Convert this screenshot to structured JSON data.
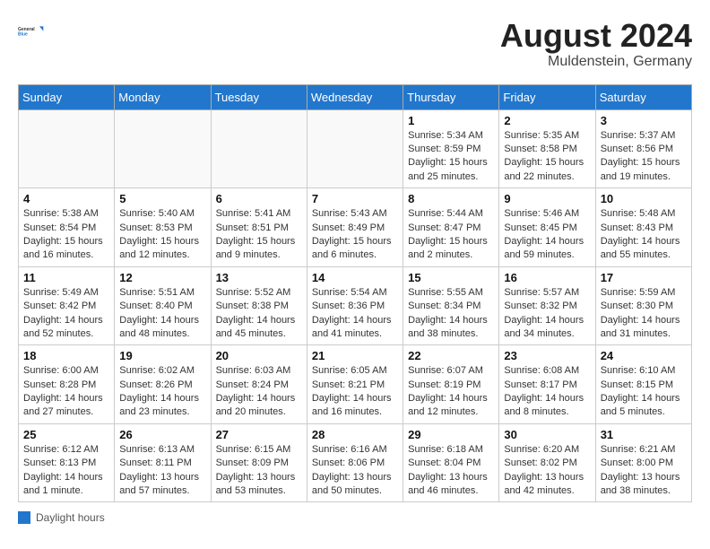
{
  "header": {
    "logo_general": "General",
    "logo_blue": "Blue",
    "month_title": "August 2024",
    "subtitle": "Muldenstein, Germany"
  },
  "footer": {
    "label": "Daylight hours"
  },
  "days_of_week": [
    "Sunday",
    "Monday",
    "Tuesday",
    "Wednesday",
    "Thursday",
    "Friday",
    "Saturday"
  ],
  "weeks": [
    [
      {
        "day": "",
        "info": ""
      },
      {
        "day": "",
        "info": ""
      },
      {
        "day": "",
        "info": ""
      },
      {
        "day": "",
        "info": ""
      },
      {
        "day": "1",
        "info": "Sunrise: 5:34 AM\nSunset: 8:59 PM\nDaylight: 15 hours\nand 25 minutes."
      },
      {
        "day": "2",
        "info": "Sunrise: 5:35 AM\nSunset: 8:58 PM\nDaylight: 15 hours\nand 22 minutes."
      },
      {
        "day": "3",
        "info": "Sunrise: 5:37 AM\nSunset: 8:56 PM\nDaylight: 15 hours\nand 19 minutes."
      }
    ],
    [
      {
        "day": "4",
        "info": "Sunrise: 5:38 AM\nSunset: 8:54 PM\nDaylight: 15 hours\nand 16 minutes."
      },
      {
        "day": "5",
        "info": "Sunrise: 5:40 AM\nSunset: 8:53 PM\nDaylight: 15 hours\nand 12 minutes."
      },
      {
        "day": "6",
        "info": "Sunrise: 5:41 AM\nSunset: 8:51 PM\nDaylight: 15 hours\nand 9 minutes."
      },
      {
        "day": "7",
        "info": "Sunrise: 5:43 AM\nSunset: 8:49 PM\nDaylight: 15 hours\nand 6 minutes."
      },
      {
        "day": "8",
        "info": "Sunrise: 5:44 AM\nSunset: 8:47 PM\nDaylight: 15 hours\nand 2 minutes."
      },
      {
        "day": "9",
        "info": "Sunrise: 5:46 AM\nSunset: 8:45 PM\nDaylight: 14 hours\nand 59 minutes."
      },
      {
        "day": "10",
        "info": "Sunrise: 5:48 AM\nSunset: 8:43 PM\nDaylight: 14 hours\nand 55 minutes."
      }
    ],
    [
      {
        "day": "11",
        "info": "Sunrise: 5:49 AM\nSunset: 8:42 PM\nDaylight: 14 hours\nand 52 minutes."
      },
      {
        "day": "12",
        "info": "Sunrise: 5:51 AM\nSunset: 8:40 PM\nDaylight: 14 hours\nand 48 minutes."
      },
      {
        "day": "13",
        "info": "Sunrise: 5:52 AM\nSunset: 8:38 PM\nDaylight: 14 hours\nand 45 minutes."
      },
      {
        "day": "14",
        "info": "Sunrise: 5:54 AM\nSunset: 8:36 PM\nDaylight: 14 hours\nand 41 minutes."
      },
      {
        "day": "15",
        "info": "Sunrise: 5:55 AM\nSunset: 8:34 PM\nDaylight: 14 hours\nand 38 minutes."
      },
      {
        "day": "16",
        "info": "Sunrise: 5:57 AM\nSunset: 8:32 PM\nDaylight: 14 hours\nand 34 minutes."
      },
      {
        "day": "17",
        "info": "Sunrise: 5:59 AM\nSunset: 8:30 PM\nDaylight: 14 hours\nand 31 minutes."
      }
    ],
    [
      {
        "day": "18",
        "info": "Sunrise: 6:00 AM\nSunset: 8:28 PM\nDaylight: 14 hours\nand 27 minutes."
      },
      {
        "day": "19",
        "info": "Sunrise: 6:02 AM\nSunset: 8:26 PM\nDaylight: 14 hours\nand 23 minutes."
      },
      {
        "day": "20",
        "info": "Sunrise: 6:03 AM\nSunset: 8:24 PM\nDaylight: 14 hours\nand 20 minutes."
      },
      {
        "day": "21",
        "info": "Sunrise: 6:05 AM\nSunset: 8:21 PM\nDaylight: 14 hours\nand 16 minutes."
      },
      {
        "day": "22",
        "info": "Sunrise: 6:07 AM\nSunset: 8:19 PM\nDaylight: 14 hours\nand 12 minutes."
      },
      {
        "day": "23",
        "info": "Sunrise: 6:08 AM\nSunset: 8:17 PM\nDaylight: 14 hours\nand 8 minutes."
      },
      {
        "day": "24",
        "info": "Sunrise: 6:10 AM\nSunset: 8:15 PM\nDaylight: 14 hours\nand 5 minutes."
      }
    ],
    [
      {
        "day": "25",
        "info": "Sunrise: 6:12 AM\nSunset: 8:13 PM\nDaylight: 14 hours\nand 1 minute."
      },
      {
        "day": "26",
        "info": "Sunrise: 6:13 AM\nSunset: 8:11 PM\nDaylight: 13 hours\nand 57 minutes."
      },
      {
        "day": "27",
        "info": "Sunrise: 6:15 AM\nSunset: 8:09 PM\nDaylight: 13 hours\nand 53 minutes."
      },
      {
        "day": "28",
        "info": "Sunrise: 6:16 AM\nSunset: 8:06 PM\nDaylight: 13 hours\nand 50 minutes."
      },
      {
        "day": "29",
        "info": "Sunrise: 6:18 AM\nSunset: 8:04 PM\nDaylight: 13 hours\nand 46 minutes."
      },
      {
        "day": "30",
        "info": "Sunrise: 6:20 AM\nSunset: 8:02 PM\nDaylight: 13 hours\nand 42 minutes."
      },
      {
        "day": "31",
        "info": "Sunrise: 6:21 AM\nSunset: 8:00 PM\nDaylight: 13 hours\nand 38 minutes."
      }
    ]
  ]
}
